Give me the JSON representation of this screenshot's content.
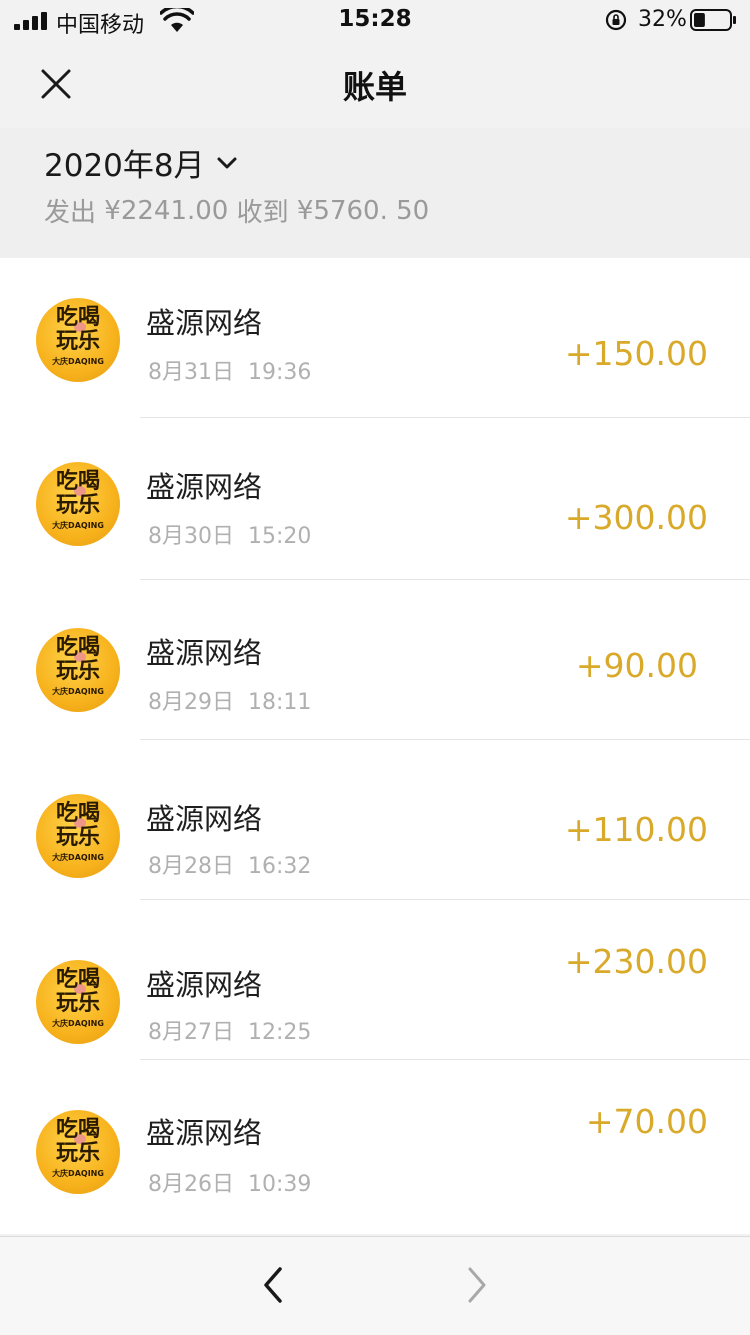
{
  "status_bar": {
    "carrier": "中国移动",
    "time": "15:28",
    "battery": "32%",
    "battery_level": 0.32
  },
  "header": {
    "title": "账单",
    "close_icon": "close-icon"
  },
  "summary": {
    "month": "2020年8月",
    "expense_label": "发出",
    "expense_value": "¥2241.00",
    "income_label": "收到",
    "income_value": "¥5760. 50"
  },
  "transactions": [
    {
      "merchant": "盛源网络",
      "datetime": "8月31日  19:36",
      "amount": "+150.00"
    },
    {
      "merchant": "盛源网络",
      "datetime": "8月30日  15:20",
      "amount": "+300.00"
    },
    {
      "merchant": "盛源网络",
      "datetime": "8月29日  18:11",
      "amount": "+90.00"
    },
    {
      "merchant": "盛源网络",
      "datetime": "8月28日  16:32",
      "amount": "+110.00"
    },
    {
      "merchant": "盛源网络",
      "datetime": "8月27日  12:25",
      "amount": "+230.00"
    },
    {
      "merchant": "盛源网络",
      "datetime": "8月26日  10:39",
      "amount": "+70.00"
    }
  ],
  "avatar_logo": {
    "line1": "吃喝",
    "line2": "玩乐",
    "sub": "大庆DAQING"
  },
  "colors": {
    "amount": "#d9a92a",
    "avatar": "#f7b21c",
    "background": "#f2f2f2"
  }
}
